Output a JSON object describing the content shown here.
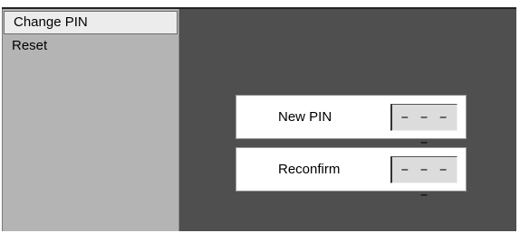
{
  "menu": {
    "items": [
      {
        "label": "Change PIN",
        "selected": true
      },
      {
        "label": "Reset",
        "selected": false
      }
    ]
  },
  "pin_form": {
    "new_pin_label": "New PIN",
    "new_pin_value": "– – – –",
    "reconfirm_label": "Reconfirm",
    "reconfirm_value": "– – – –"
  },
  "colors": {
    "background": "#4f4f4f",
    "sidebar": "#b4b4b4",
    "selected_item": "#ececec",
    "field": "#dcdcdc"
  }
}
